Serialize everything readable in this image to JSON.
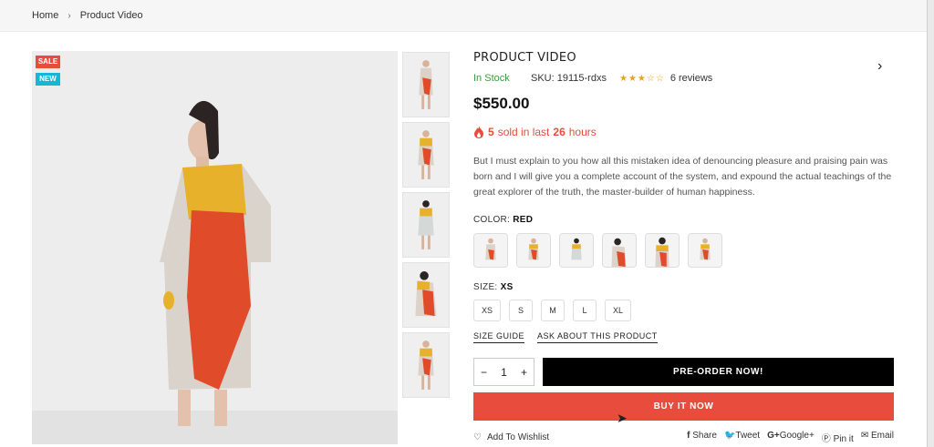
{
  "breadcrumb": {
    "home": "Home",
    "separator": "›",
    "current": "Product Video"
  },
  "badges": {
    "sale": "SALE",
    "new": "NEW"
  },
  "product": {
    "title": "PRODUCT VIDEO",
    "stock": "In Stock",
    "sku": "SKU: 19115-rdxs",
    "rating_stars": "★★★☆☆",
    "rating": 3,
    "reviews": "6 reviews",
    "price": "$550.00",
    "sold_count": "5",
    "sold_mid": "sold in last",
    "sold_hours": "26",
    "sold_unit": "hours",
    "description": "But I must explain to you how all this mistaken idea of denouncing pleasure and praising pain was born and I will give you a complete account of the system, and expound the actual teachings of the great explorer of the truth, the master-builder of human happiness."
  },
  "color": {
    "label": "COLOR:",
    "value": "RED"
  },
  "size": {
    "label": "SIZE:",
    "value": "XS",
    "options": [
      "XS",
      "S",
      "M",
      "L",
      "XL"
    ]
  },
  "links": {
    "size_guide": "SIZE GUIDE",
    "ask": "ASK ABOUT THIS PRODUCT"
  },
  "quantity": {
    "minus": "−",
    "value": "1",
    "plus": "+"
  },
  "buttons": {
    "preorder": "PRE-ORDER NOW!",
    "buy_now": "BUY IT NOW"
  },
  "wishlist": "Add To Wishlist",
  "share": {
    "facebook": "Share",
    "twitter": "Tweet",
    "google": "Google+",
    "pinterest": "Pin it",
    "email": "Email"
  },
  "colors": {
    "accent": "#e74c3c",
    "new_badge": "#17b6d6",
    "stock": "#3a9d3a",
    "stars": "#e8a21a",
    "dark": "#000000"
  }
}
